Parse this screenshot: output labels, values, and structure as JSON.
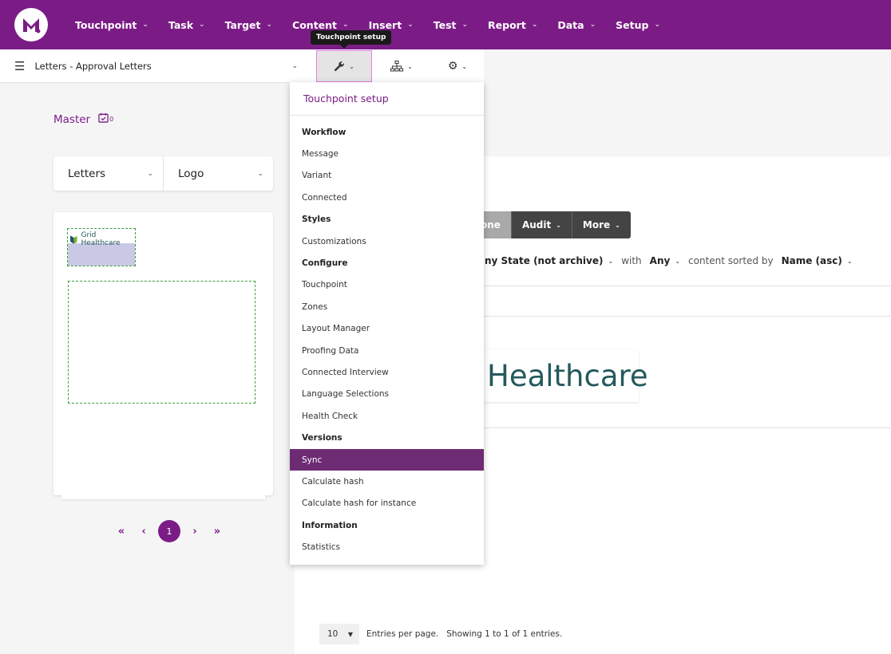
{
  "topnav": {
    "items": [
      {
        "label": "Touchpoint"
      },
      {
        "label": "Task"
      },
      {
        "label": "Target"
      },
      {
        "label": "Content"
      },
      {
        "label": "Insert"
      },
      {
        "label": "Test"
      },
      {
        "label": "Report"
      },
      {
        "label": "Data"
      },
      {
        "label": "Setup"
      }
    ]
  },
  "tooltip": "Touchpoint setup",
  "subbar": {
    "touchpoint_name": "Letters - Approval Letters"
  },
  "left": {
    "master_label": "Master",
    "master_count": "0",
    "selector": {
      "channel": "Letters",
      "zone": "Logo"
    },
    "preview_logo_text": "Grid Healthcare",
    "pager": {
      "first": "«",
      "prev": "‹",
      "current": "1",
      "next": "›",
      "last": "»"
    }
  },
  "content": {
    "buttons": [
      "one",
      "Audit",
      "More"
    ],
    "filter": {
      "state": "ny State (not archive)",
      "with": "with",
      "any": "Any",
      "sorted_by": "content sorted by",
      "sort": "Name (asc)"
    },
    "preview_text": "Healthcare",
    "footer": {
      "per_page_value": "10",
      "per_page_label": "Entries per page.",
      "showing": "Showing 1 to 1 of 1 entries."
    }
  },
  "dropdown": {
    "title": "Touchpoint setup",
    "items": [
      {
        "label": "Workflow",
        "section": true
      },
      {
        "label": "Message"
      },
      {
        "label": "Variant"
      },
      {
        "label": "Connected"
      },
      {
        "label": "Styles",
        "section": true
      },
      {
        "label": "Customizations"
      },
      {
        "label": "Configure",
        "section": true
      },
      {
        "label": "Touchpoint"
      },
      {
        "label": "Zones"
      },
      {
        "label": "Layout Manager"
      },
      {
        "label": "Proofing Data"
      },
      {
        "label": "Connected Interview"
      },
      {
        "label": "Language Selections"
      },
      {
        "label": "Health Check"
      },
      {
        "label": "Versions",
        "section": true
      },
      {
        "label": "Sync",
        "selected": true
      },
      {
        "label": "Calculate hash"
      },
      {
        "label": "Calculate hash for instance"
      },
      {
        "label": "Information",
        "section": true
      },
      {
        "label": "Statistics"
      }
    ]
  },
  "colors": {
    "brand": "#7b1c86",
    "selected": "#6d2b73",
    "accent_teal": "#24595c"
  }
}
